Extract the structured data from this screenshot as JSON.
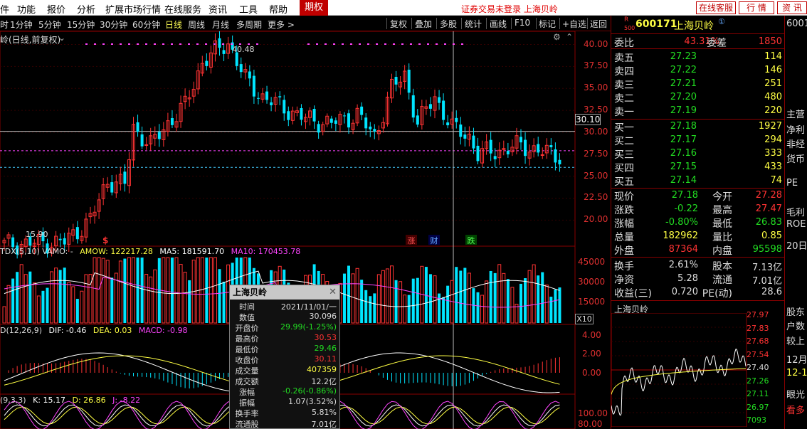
{
  "menu": {
    "items": [
      "件",
      "功能",
      "报价",
      "分析",
      "扩展市场行情",
      "在线服务",
      "资讯",
      "工具",
      "帮助"
    ],
    "qiquan": "期权",
    "login_note": "证券交易未登录 上海贝岭",
    "online_service": "在线客服",
    "quote_btn": "行 情",
    "info_btn": "资 讯"
  },
  "toolbar": {
    "periods": [
      "时",
      "1分钟",
      "5分钟",
      "15分钟",
      "30分钟",
      "60分钟",
      "日线",
      "周线",
      "月线",
      "多周期",
      "更多 >"
    ],
    "active_period": "日线",
    "tools": [
      "复权",
      "叠加",
      "多股",
      "统计",
      "画线",
      "F10",
      "标记",
      "+自选",
      "返回"
    ]
  },
  "chart_header": {
    "title": "岭(日线,前复权)",
    "price_max_label": "40.48",
    "price_min_label": "15.90",
    "crosshair_price": "30.10"
  },
  "chart_data": [
    {
      "type": "candlestick",
      "name": "price",
      "yticks": [
        20.0,
        22.5,
        25.0,
        27.5,
        30.0,
        32.5,
        35.0,
        37.5,
        40.0
      ],
      "ylim": [
        18.0,
        41.5
      ],
      "max_label": 40.48,
      "min_label": 15.9,
      "reference_lines": [
        30.1,
        27.9,
        26.0
      ],
      "event_markers": [
        "$",
        "涨",
        "财",
        "跌"
      ]
    },
    {
      "type": "bar",
      "name": "volume",
      "header": [
        "TDX(5,10) VAMO: -",
        "AMOW: 122217.28",
        "MA5: 181591.70",
        "MA10: 170453.78"
      ],
      "yticks": [
        "45000",
        "30000",
        "15000"
      ],
      "unit": "X10"
    },
    {
      "type": "line",
      "name": "MACD",
      "header": [
        "D(12,26,9)",
        "DIF: -0.46",
        "DEA: 0.03",
        "MACD: -0.98"
      ],
      "yticks": [
        "4.00",
        "2.00",
        "0.00"
      ]
    },
    {
      "type": "line",
      "name": "KDJ",
      "header": [
        "(9,3,3)",
        "K: 15.17",
        "D: 26.86",
        "J: -8.22"
      ],
      "yticks": [
        "100.00",
        "80.00"
      ]
    }
  ],
  "quote": {
    "code": "600171",
    "name": "上海贝岭",
    "r_badge": "R",
    "num_badge": "500",
    "webi_label": "委比",
    "webi_value": "43.31%",
    "weicha_label": "委差",
    "weicha_value": "1850",
    "asks": [
      {
        "label": "卖五",
        "price": "27.23",
        "vol": "114"
      },
      {
        "label": "卖四",
        "price": "27.22",
        "vol": "146"
      },
      {
        "label": "卖三",
        "price": "27.21",
        "vol": "251"
      },
      {
        "label": "卖二",
        "price": "27.20",
        "vol": "480"
      },
      {
        "label": "卖一",
        "price": "27.19",
        "vol": "220"
      }
    ],
    "bids": [
      {
        "label": "买一",
        "price": "27.18",
        "vol": "1927"
      },
      {
        "label": "买二",
        "price": "27.17",
        "vol": "294"
      },
      {
        "label": "买三",
        "price": "27.16",
        "vol": "333"
      },
      {
        "label": "买四",
        "price": "27.15",
        "vol": "433"
      },
      {
        "label": "买五",
        "price": "27.14",
        "vol": "74"
      }
    ],
    "stats": [
      {
        "l1": "现价",
        "v1": "27.18",
        "c1": "#22dd22",
        "l2": "今开",
        "v2": "27.28",
        "c2": "#ff3333"
      },
      {
        "l1": "涨跌",
        "v1": "-0.22",
        "c1": "#22dd22",
        "l2": "最高",
        "v2": "27.47",
        "c2": "#ff3333"
      },
      {
        "l1": "涨幅",
        "v1": "-0.80%",
        "c1": "#22dd22",
        "l2": "最低",
        "v2": "26.83",
        "c2": "#22dd22"
      },
      {
        "l1": "总量",
        "v1": "182962",
        "c1": "#ffff44",
        "l2": "量比",
        "v2": "0.85",
        "c2": "#ffff44"
      },
      {
        "l1": "外盘",
        "v1": "87364",
        "c1": "#ff3333",
        "l2": "内盘",
        "v2": "95598",
        "c2": "#22dd22"
      },
      {
        "l1": "换手",
        "v1": "2.61%",
        "c1": "#dddddd",
        "l2": "股本",
        "v2": "7.13亿",
        "c2": "#dddddd"
      },
      {
        "l1": "净资",
        "v1": "5.28",
        "c1": "#dddddd",
        "l2": "流通",
        "v2": "7.01亿",
        "c2": "#dddddd"
      },
      {
        "l1": "收益(三)",
        "v1": "0.720",
        "c1": "#dddddd",
        "l2": "PE(动)",
        "v2": "28.6",
        "c2": "#dddddd"
      }
    ],
    "mini_title": "上海贝岭",
    "mini_yticks": [
      "27.97",
      "27.83",
      "27.68",
      "27.54",
      "27.40",
      "27.26",
      "27.11",
      "26.97",
      "7093"
    ]
  },
  "right_strip": [
    "6001",
    "主营",
    "净利",
    "非经",
    "货币",
    "PE",
    "毛利",
    "ROE",
    "20日",
    "股东",
    "户数",
    "较上",
    "12月",
    "12-1",
    "眼光",
    "看多"
  ],
  "tooltip": {
    "title": "上海贝岭",
    "rows": [
      {
        "label": "时间",
        "value": "2021/11/01/一",
        "color": "#dddddd"
      },
      {
        "label": "数值",
        "value": "30.096",
        "color": "#dddddd"
      },
      {
        "label": "开盘价",
        "value": "29.99(-1.25%)",
        "color": "#22dd22"
      },
      {
        "label": "最高价",
        "value": "30.53",
        "color": "#ff3333"
      },
      {
        "label": "最低价",
        "value": "29.46",
        "color": "#22dd22"
      },
      {
        "label": "收盘价",
        "value": "30.11",
        "color": "#ff3333"
      },
      {
        "label": "成交量",
        "value": "407359",
        "color": "#ffff44"
      },
      {
        "label": "成交额",
        "value": "12.2亿",
        "color": "#dddddd"
      },
      {
        "label": "涨幅",
        "value": "-0.26(-0.86%)",
        "color": "#22dd22"
      },
      {
        "label": "振幅",
        "value": "1.07(3.52%)",
        "color": "#dddddd"
      },
      {
        "label": "换手率",
        "value": "5.81%",
        "color": "#dddddd"
      },
      {
        "label": "流通股",
        "value": "7.01亿",
        "color": "#dddddd"
      }
    ]
  }
}
